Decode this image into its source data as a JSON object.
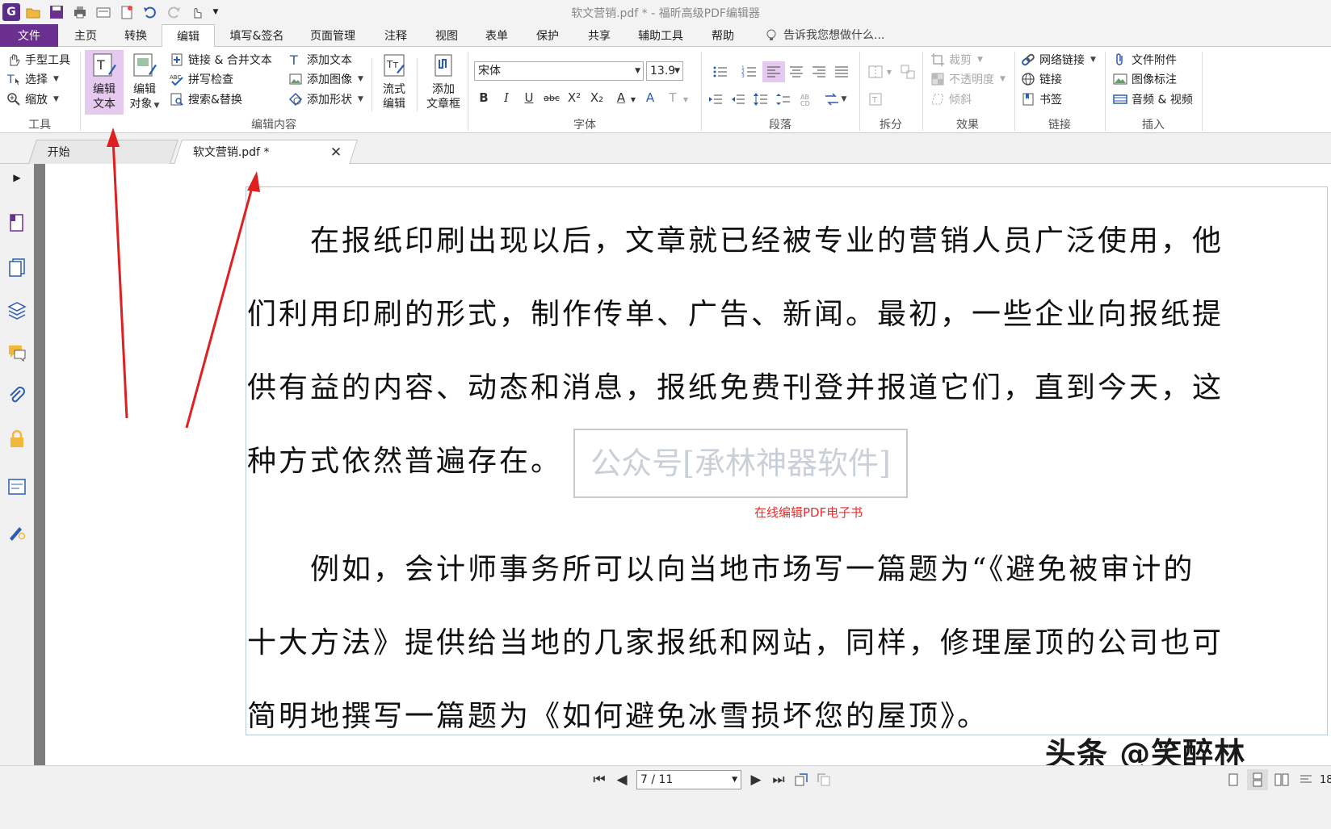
{
  "window": {
    "title": "软文营销.pdf * - 福昕高级PDF编辑器"
  },
  "menu_tabs": [
    "文件",
    "主页",
    "转换",
    "编辑",
    "填写&签名",
    "页面管理",
    "注释",
    "视图",
    "表单",
    "保护",
    "共享",
    "辅助工具",
    "帮助"
  ],
  "active_tab": "编辑",
  "tell_me": "告诉我您想做什么...",
  "ribbon": {
    "tools": {
      "label": "工具",
      "hand": "手型工具",
      "select": "选择",
      "zoom": "缩放"
    },
    "edit_content": {
      "label": "编辑内容",
      "edit_text": [
        "编辑",
        "文本"
      ],
      "edit_object": [
        "编辑",
        "对象"
      ],
      "link_merge": "链接 & 合并文本",
      "spell_check": "拼写检查",
      "search_replace": "搜索&替换",
      "add_text": "添加文本",
      "add_image": "添加图像",
      "add_shape": "添加形状",
      "flow_edit": [
        "流式",
        "编辑"
      ],
      "add_textbox": [
        "添加",
        "文章框"
      ]
    },
    "font": {
      "label": "字体",
      "name": "宋体",
      "size": "13.9",
      "buttons": [
        "B",
        "I",
        "U",
        "abc",
        "X²",
        "X₂",
        "A",
        "A",
        "T"
      ]
    },
    "paragraph": {
      "label": "段落"
    },
    "split": {
      "label": "拆分"
    },
    "effects": {
      "label": "效果",
      "crop": "裁剪",
      "opacity": "不透明度",
      "skew": "倾斜"
    },
    "links": {
      "label": "链接",
      "web_link": "网络链接",
      "link": "链接",
      "bookmark": "书签"
    },
    "insert": {
      "label": "插入",
      "attachment": "文件附件",
      "image_annotation": "图像标注",
      "audio_video": "音频 & 视频"
    }
  },
  "doc_tabs": [
    {
      "label": "开始",
      "active": false
    },
    {
      "label": "软文营销.pdf *",
      "active": true
    }
  ],
  "document": {
    "para1": [
      "　　在报纸印刷出现以后，文章就已经被专业的营销人员广泛使用，他",
      "们利用印刷的形式，制作传单、广告、新闻。最初，一些企业向报纸提",
      "供有益的内容、动态和消息，报纸免费刊登并报道它们，直到今天，这",
      "种方式依然普遍存在。"
    ],
    "watermark": "公众号[承林神器软件]",
    "red_note": "在线编辑PDF电子书",
    "para2": [
      "　　例如，会计师事务所可以向当地市场写一篇题为“《避免被审计的",
      "十大方法》提供给当地的几家报纸和网站，同样，修理屋顶的公司也可",
      "简明地撰写一篇题为《如何避免冰雪损坏您的屋顶》。"
    ],
    "signature": "头条 @笑醉林"
  },
  "status": {
    "page": "7 / 11",
    "zoom_partial": "18"
  },
  "colors": {
    "accent": "#6a2f8f",
    "selected": "#e6c9ef",
    "arrow": "#e02020"
  }
}
